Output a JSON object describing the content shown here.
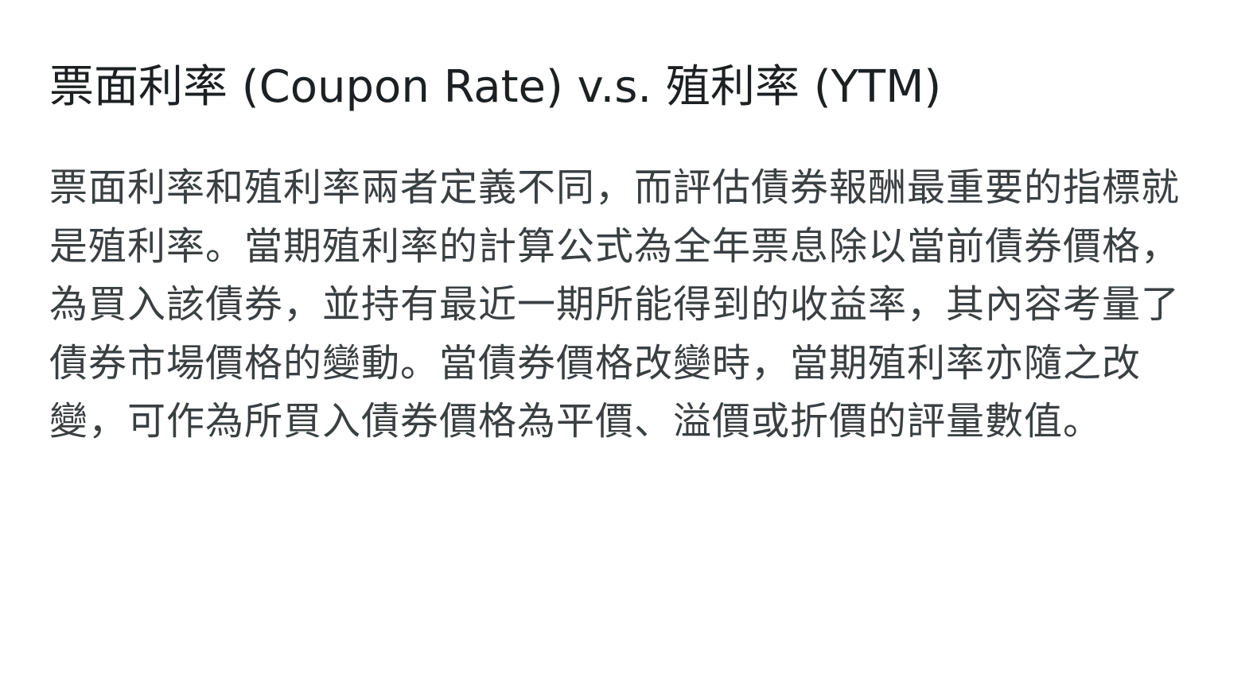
{
  "article": {
    "title": "票面利率 (Coupon Rate)  v.s. 殖利率 (YTM)",
    "paragraph": "票面利率和殖利率兩者定義不同，而評估債券報酬最重要的指標就是殖利率。當期殖利率的計算公式為全年票息除以當前債券價格，為買入該債券，並持有最近一期所能得到的收益率，其內容考量了債券市場價格的變動。當債券價格改變時，當期殖利率亦隨之改變，可作為所買入債券價格為平價、溢價或折價的評量數值。"
  }
}
